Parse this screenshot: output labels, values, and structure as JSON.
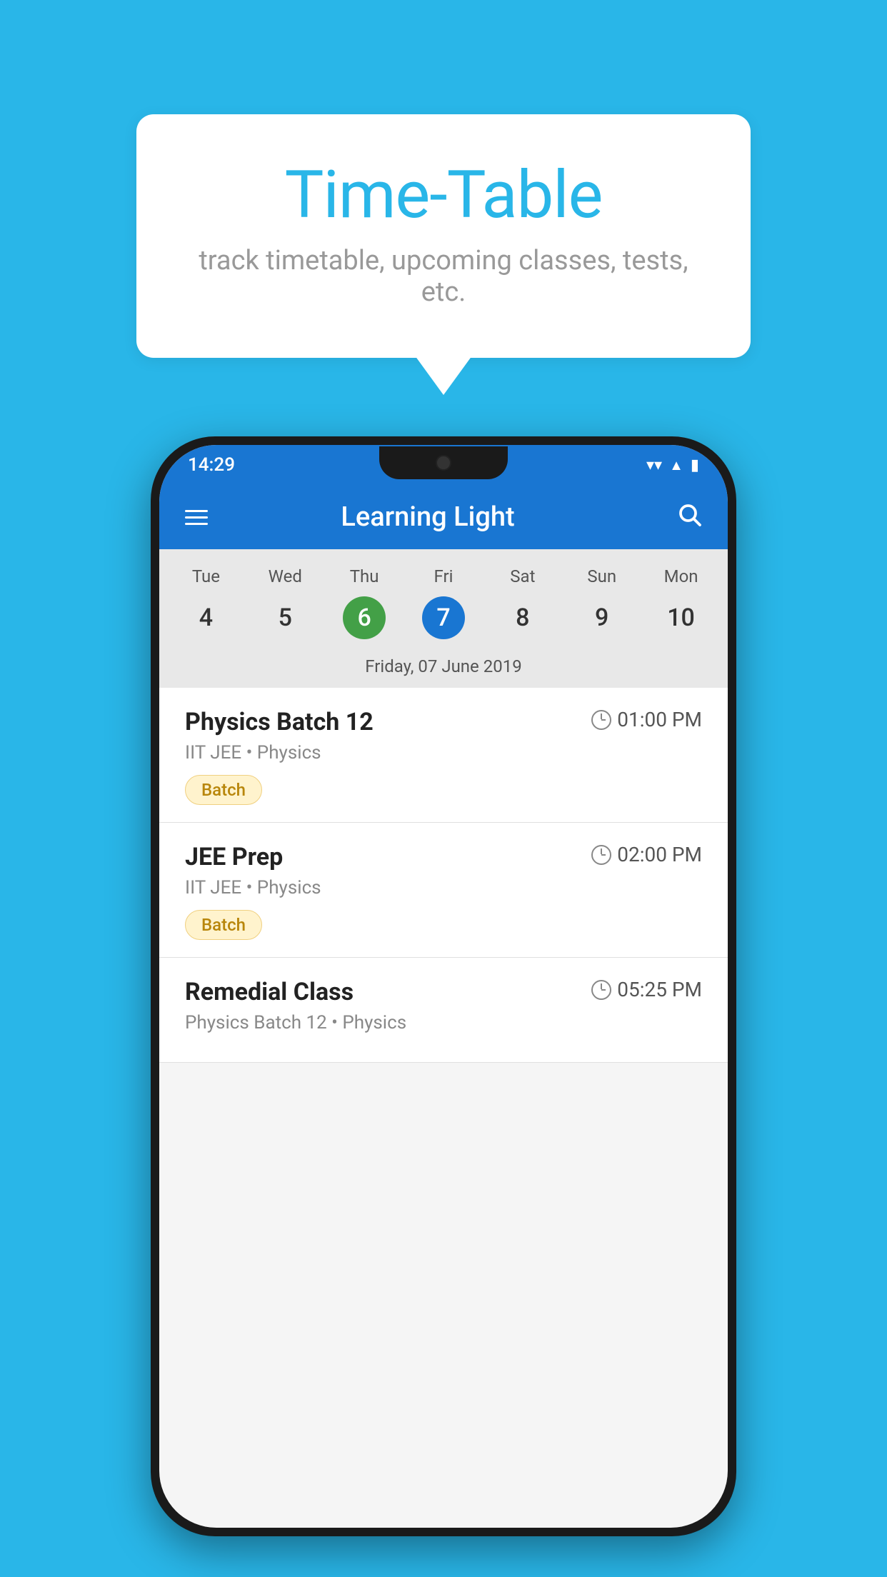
{
  "background_color": "#29B6E8",
  "tooltip": {
    "title": "Time-Table",
    "subtitle": "track timetable, upcoming classes, tests, etc."
  },
  "status_bar": {
    "time": "14:29"
  },
  "app_bar": {
    "title": "Learning Light"
  },
  "calendar": {
    "days": [
      {
        "label": "Tue",
        "num": "4",
        "state": "normal"
      },
      {
        "label": "Wed",
        "num": "5",
        "state": "normal"
      },
      {
        "label": "Thu",
        "num": "6",
        "state": "today"
      },
      {
        "label": "Fri",
        "num": "7",
        "state": "selected"
      },
      {
        "label": "Sat",
        "num": "8",
        "state": "normal"
      },
      {
        "label": "Sun",
        "num": "9",
        "state": "normal"
      },
      {
        "label": "Mon",
        "num": "10",
        "state": "normal"
      }
    ],
    "selected_date": "Friday, 07 June 2019"
  },
  "schedule": [
    {
      "name": "Physics Batch 12",
      "time": "01:00 PM",
      "subtitle": "IIT JEE • Physics",
      "badge": "Batch"
    },
    {
      "name": "JEE Prep",
      "time": "02:00 PM",
      "subtitle": "IIT JEE • Physics",
      "badge": "Batch"
    },
    {
      "name": "Remedial Class",
      "time": "05:25 PM",
      "subtitle": "Physics Batch 12 • Physics",
      "badge": null
    }
  ]
}
